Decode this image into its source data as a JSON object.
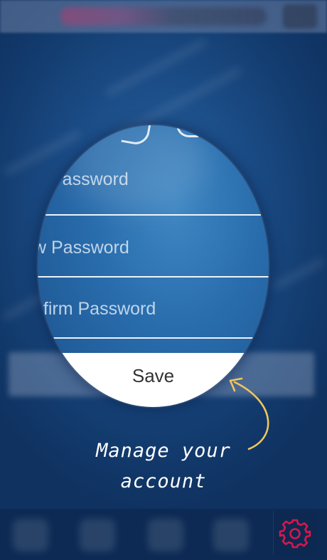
{
  "form": {
    "current_password_label": "Password",
    "new_password_label": "w Password",
    "confirm_password_label": "nfirm Password",
    "save_label": "Save"
  },
  "callout": {
    "line1": "Manage your",
    "line2": "account"
  },
  "icons": {
    "settings": "gear-icon",
    "arrow": "curved-arrow-icon"
  },
  "colors": {
    "background": "#153e72",
    "gear_accent": "#d8174c",
    "arrow": "#f2c55c",
    "save_button": "#ffffff"
  }
}
